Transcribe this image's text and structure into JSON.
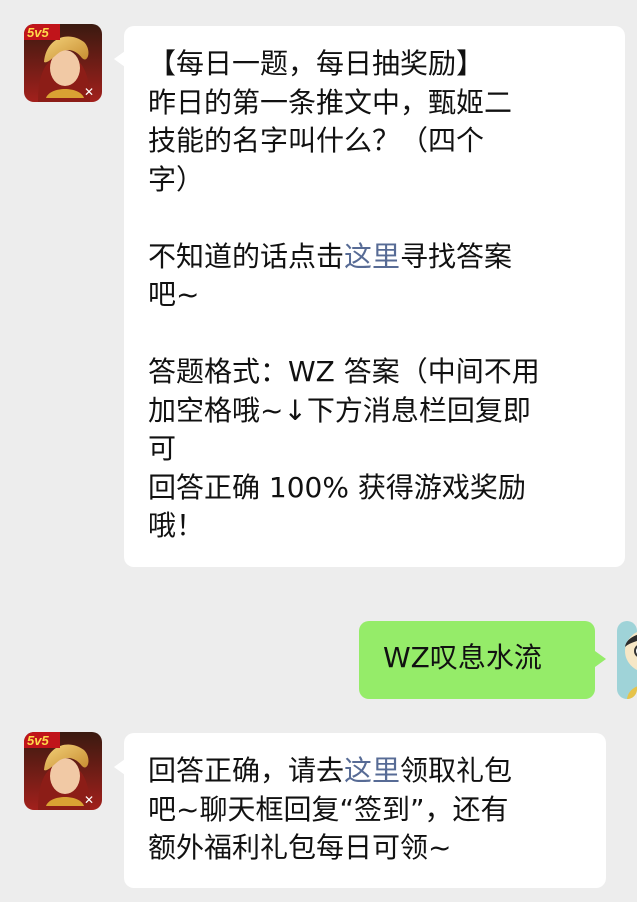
{
  "messages": [
    {
      "from": "official-account",
      "avatar_icon": "game-hero-avatar-icon",
      "avatar_badge": "5v5",
      "lines": [
        "【每日一题，每日抽奖励】",
        "昨日的第一条推文中，甄姬二",
        "技能的名字叫什么？（四个",
        "字）",
        "",
        {
          "before": "不知道的话点击",
          "link": "这里",
          "after": "寻找答案"
        },
        "吧~",
        "",
        "答题格式：WZ 答案（中间不用",
        "加空格哦~↓下方消息栏回复即",
        "可",
        "回答正确 100% 获得游戏奖励",
        "哦！"
      ]
    },
    {
      "from": "user",
      "avatar_icon": "cartoon-character-avatar-icon",
      "text": "WZ叹息水流"
    },
    {
      "from": "official-account",
      "avatar_icon": "game-hero-avatar-icon",
      "avatar_badge": "5v5",
      "lines": [
        {
          "before": "回答正确，请去",
          "link": "这里",
          "after": "领取礼包"
        },
        "吧~聊天框回复“签到”，还有",
        "额外福利礼包每日可领~"
      ]
    }
  ],
  "colors": {
    "background": "#ededed",
    "incoming_bubble": "#ffffff",
    "outgoing_bubble": "#95ec69",
    "link": "#576b95"
  }
}
